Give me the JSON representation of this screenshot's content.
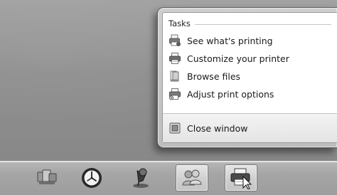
{
  "jumplist": {
    "section_title": "Tasks",
    "tasks": [
      {
        "label": "See what's printing",
        "icon": "printer-queue-icon"
      },
      {
        "label": "Customize your printer",
        "icon": "printer-icon"
      },
      {
        "label": "Browse files",
        "icon": "folder-icon"
      },
      {
        "label": "Adjust print options",
        "icon": "print-options-icon"
      }
    ],
    "footer_item": {
      "label": "Close window",
      "icon": "close-window-icon"
    }
  },
  "taskbar": {
    "buttons": [
      {
        "icon": "devices-icon",
        "active": false
      },
      {
        "icon": "clock-icon",
        "active": false
      },
      {
        "icon": "pin-icon",
        "active": false
      },
      {
        "icon": "users-icon",
        "active": true
      },
      {
        "icon": "printer-icon",
        "active": true
      }
    ]
  }
}
